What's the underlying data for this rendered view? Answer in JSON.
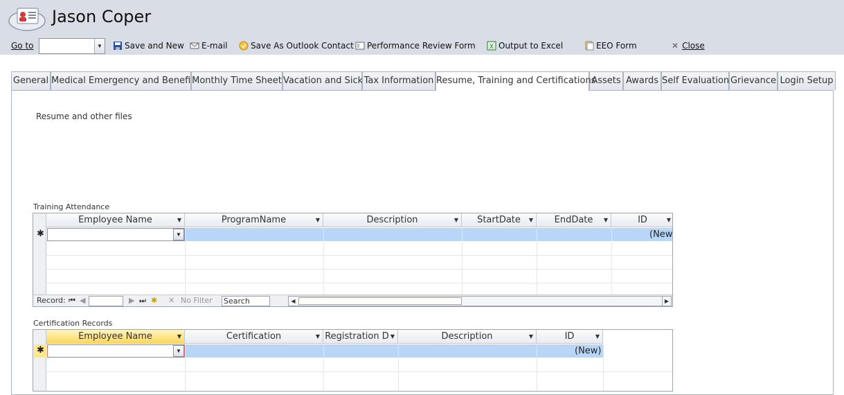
{
  "window": {
    "title": "Jason Coper"
  },
  "toolbar": {
    "goto_label": "Go to",
    "goto_value": "",
    "save_and_new": "Save and New",
    "email": "E-mail",
    "save_as_outlook": "Save As Outlook Contact",
    "performance_review": "Performance Review Form",
    "output_excel": "Output to Excel",
    "eeo_form": "EEO Form",
    "close": "Close"
  },
  "tabs": [
    {
      "label": "General"
    },
    {
      "label": "Medical Emergency and Benefits"
    },
    {
      "label": "Monthly Time Sheet"
    },
    {
      "label": "Vacation and Sick"
    },
    {
      "label": "Tax Information"
    },
    {
      "label": "Resume, Training and Certifications",
      "active": true
    },
    {
      "label": "Assets"
    },
    {
      "label": "Awards"
    },
    {
      "label": "Self Evaluation"
    },
    {
      "label": "Grievance"
    },
    {
      "label": "Login Setup"
    }
  ],
  "resume": {
    "label": "Resume and other files"
  },
  "training": {
    "label": "Training Attendance",
    "columns": [
      "Employee Name",
      "ProgramName",
      "Description",
      "StartDate",
      "EndDate",
      "ID"
    ],
    "new_row_id": "(New",
    "nav": {
      "record_label": "Record:",
      "no_filter": "No Filter",
      "search": "Search"
    }
  },
  "certification": {
    "label": "Certification Records",
    "columns": [
      "Employee Name",
      "Certification",
      "Registration D",
      "Description",
      "ID"
    ],
    "new_row_id": "(New)"
  },
  "colors": {
    "header_bg": "#d8dde6",
    "selected_cell": "#b8d7f8",
    "active_header": "#ffd95a"
  }
}
